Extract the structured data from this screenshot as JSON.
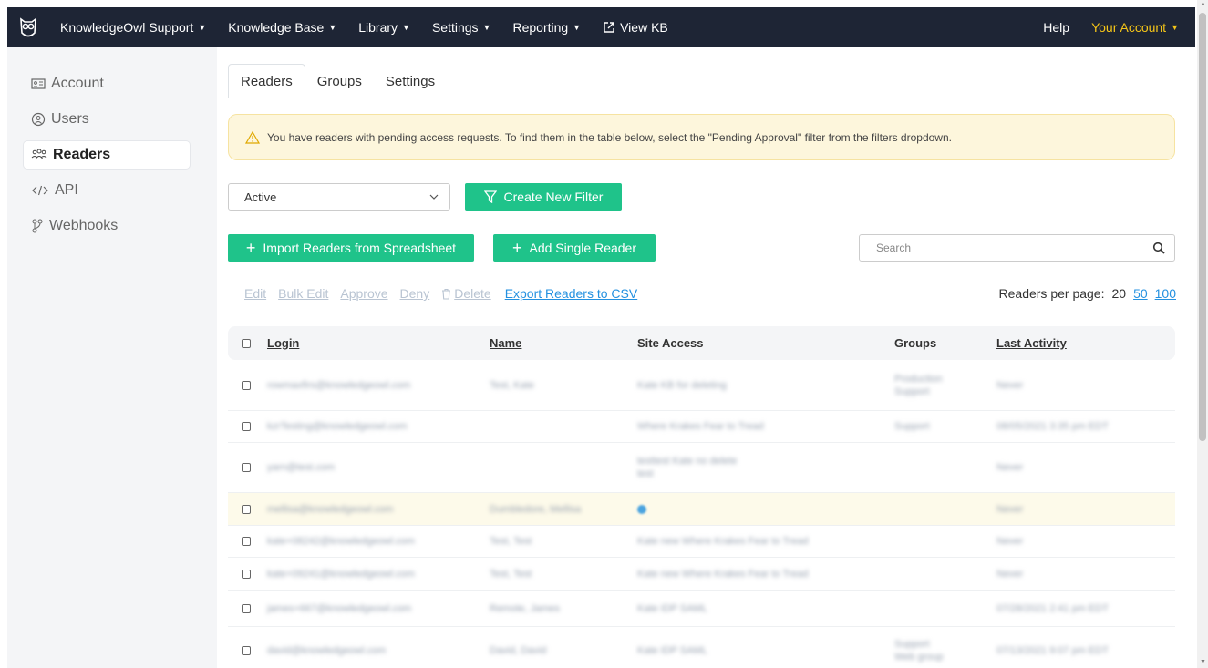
{
  "topbar": {
    "brand": "KnowledgeOwl Support",
    "items": [
      "Knowledge Base",
      "Library",
      "Settings",
      "Reporting"
    ],
    "view_kb": "View KB",
    "help": "Help",
    "account": "Your Account",
    "icon": "owl-logo-icon"
  },
  "sidebar": {
    "items": [
      {
        "label": "Account",
        "icon": "id-card-icon"
      },
      {
        "label": "Users",
        "icon": "user-circle-icon"
      },
      {
        "label": "Readers",
        "icon": "readers-icon"
      },
      {
        "label": "API",
        "icon": "code-icon"
      },
      {
        "label": "Webhooks",
        "icon": "webhook-icon"
      }
    ],
    "active": "Readers"
  },
  "tabs": [
    "Readers",
    "Groups",
    "Settings"
  ],
  "alert": {
    "text": "You have readers with pending access requests. To find them in the table below, select the \"Pending Approval\" filter from the filters dropdown."
  },
  "filter": {
    "selected": "Active",
    "create_label": "Create New Filter"
  },
  "buttons": {
    "import": "Import Readers from Spreadsheet",
    "add": "Add Single Reader"
  },
  "search": {
    "placeholder": "Search"
  },
  "actions": {
    "edit": "Edit",
    "bulk_edit": "Bulk Edit",
    "approve": "Approve",
    "deny": "Deny",
    "delete": "Delete",
    "export": "Export Readers to CSV"
  },
  "perpage": {
    "label": "Readers per page:",
    "options": [
      "20",
      "50",
      "100"
    ]
  },
  "table": {
    "columns": [
      "Login",
      "Name",
      "Site Access",
      "Groups",
      "Last Activity"
    ],
    "rows": [
      {
        "login": "rowmaxfirs@knowledgeowl.com",
        "name": "Test, Kate",
        "access": "Kate KB for deleting",
        "groups": "Production Support",
        "last": "Never"
      },
      {
        "login": "kzrTesting@knowledgeowl.com",
        "name": "",
        "access": "Where Krakes Fear to Tread",
        "groups": "Support",
        "last": "08/05/2021 3:35 pm EDT"
      },
      {
        "login": "yarn@test.com",
        "name": "",
        "access": "testtest Kate no delete test",
        "groups": "",
        "last": "Never"
      },
      {
        "login": "mellisa@knowledgeowl.com",
        "name": "Dumbledore, Mellisa",
        "access": "",
        "groups": "",
        "last": "Never"
      },
      {
        "login": "kate+08242@knowledgeowl.com",
        "name": "Test, Test",
        "access": "Kate new Where Krakes Fear to Tread",
        "groups": "",
        "last": "Never"
      },
      {
        "login": "kate+09241@knowledgeowl.com",
        "name": "Test, Test",
        "access": "Kate new Where Krakes Fear to Tread",
        "groups": "",
        "last": "Never"
      },
      {
        "login": "james+667@knowledgeowl.com",
        "name": "Remote, James",
        "access": "Kate IDP SAML",
        "groups": "",
        "last": "07/28/2021 2:41 pm EDT"
      },
      {
        "login": "david@knowledgeowl.com",
        "name": "David, David",
        "access": "Kate IDP SAML",
        "groups": "Support Web group",
        "last": "07/13/2021 9:07 pm EDT"
      }
    ]
  }
}
